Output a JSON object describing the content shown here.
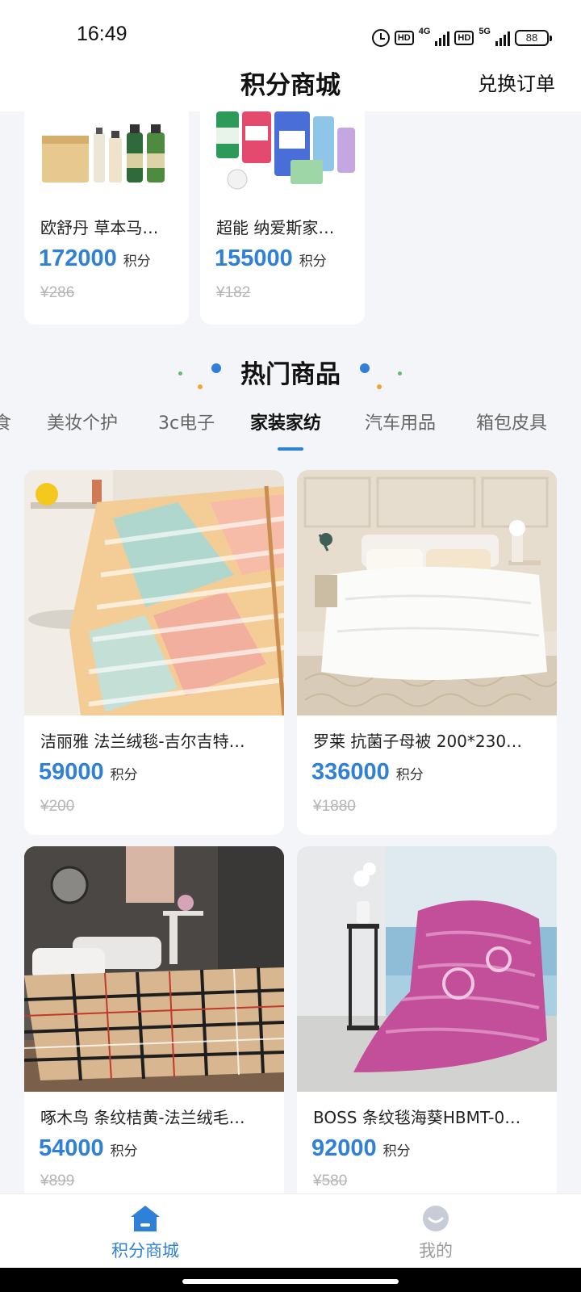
{
  "status_bar": {
    "time": "16:49",
    "network1": "4G",
    "network2": "5G",
    "hd": "HD",
    "battery": "88"
  },
  "header": {
    "title": "积分商城",
    "action": "兑换订单"
  },
  "top_products": [
    {
      "name": "欧舒丹 草本马…",
      "points": "172000",
      "unit": "积分",
      "original_price": "¥286",
      "image_icon": "skincare-products-image"
    },
    {
      "name": "超能 纳爱斯家…",
      "points": "155000",
      "unit": "积分",
      "original_price": "¥182",
      "image_icon": "household-products-image"
    }
  ],
  "section": {
    "title": "热门商品"
  },
  "tabs": [
    {
      "label": "食"
    },
    {
      "label": "美妆个护"
    },
    {
      "label": "3c电子"
    },
    {
      "label": "家装家纺"
    },
    {
      "label": "汽车用品"
    },
    {
      "label": "箱包皮具"
    }
  ],
  "active_tab": "家装家纺",
  "products": [
    {
      "name": "洁丽雅 法兰绒毯-吉尔吉特…",
      "points": "59000",
      "unit": "积分",
      "original_price": "¥200",
      "image_icon": "pastel-blanket-image"
    },
    {
      "name": "罗莱 抗菌子母被 200*230…",
      "points": "336000",
      "unit": "积分",
      "original_price": "¥1880",
      "image_icon": "white-quilt-bed-image"
    },
    {
      "name": "啄木鸟 条纹桔黄-法兰绒毛…",
      "points": "54000",
      "unit": "积分",
      "original_price": "¥899",
      "image_icon": "plaid-blanket-bed-image"
    },
    {
      "name": "BOSS 条纹毯海葵HBMT-0…",
      "points": "92000",
      "unit": "积分",
      "original_price": "¥580",
      "image_icon": "pink-blanket-image"
    }
  ],
  "bottom_nav": [
    {
      "label": "积分商城",
      "icon": "home-icon",
      "active": true
    },
    {
      "label": "我的",
      "icon": "profile-icon",
      "active": false
    }
  ],
  "colors": {
    "accent": "#2f80d8",
    "background": "#f4f5f9",
    "inactive": "#9a9a9a"
  }
}
